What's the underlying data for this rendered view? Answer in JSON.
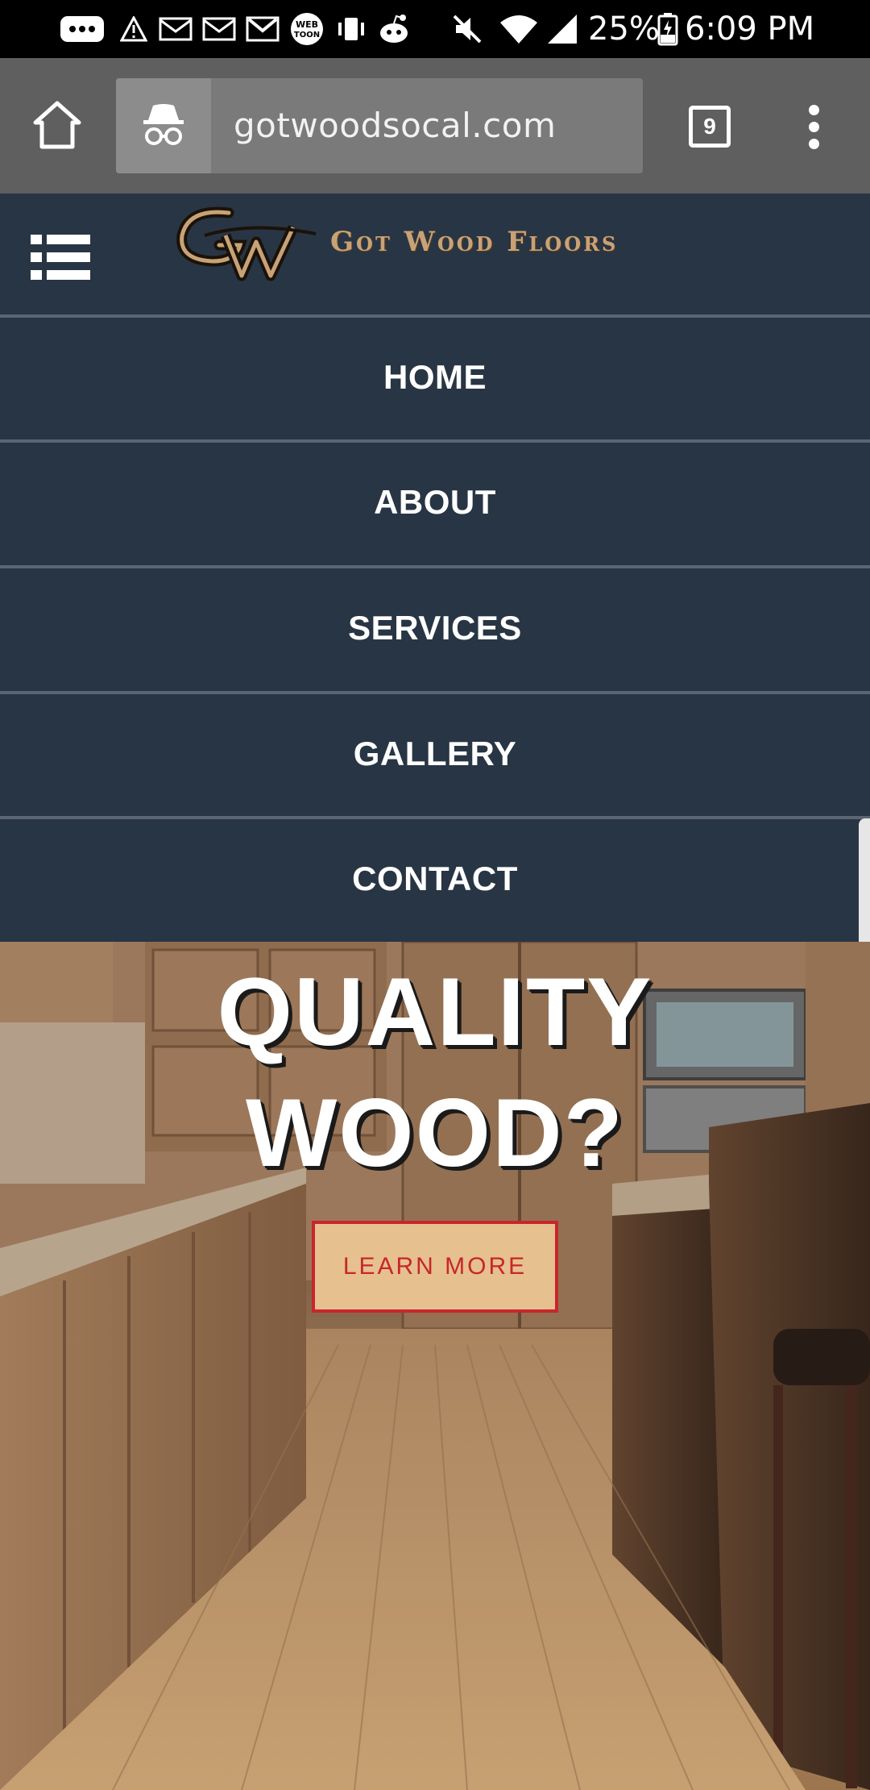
{
  "status_bar": {
    "battery_percent": "25%",
    "time": "6:09 PM",
    "icons": [
      "messages-icon",
      "warning-icon",
      "mail-icon",
      "mail-icon",
      "gmail-icon",
      "webtoon-icon",
      "vibrate-icon",
      "reddit-icon",
      "mute-icon",
      "wifi-icon",
      "signal-icon",
      "battery-charging-icon"
    ]
  },
  "browser": {
    "url": "gotwoodsocal.com",
    "tab_count": "9",
    "mode": "incognito"
  },
  "site": {
    "brand": "Got Wood Floors",
    "logo_letters": "GW",
    "nav": [
      "HOME",
      "ABOUT",
      "SERVICES",
      "GALLERY",
      "CONTACT"
    ]
  },
  "hero": {
    "title_line1": "QUALITY",
    "title_line2": "WOOD?",
    "button_label": "LEARN MORE"
  },
  "colors": {
    "header_bg": "#283544",
    "brand_gold": "#c8a276",
    "button_bg": "#e6c08f",
    "button_accent": "#c8262b"
  }
}
